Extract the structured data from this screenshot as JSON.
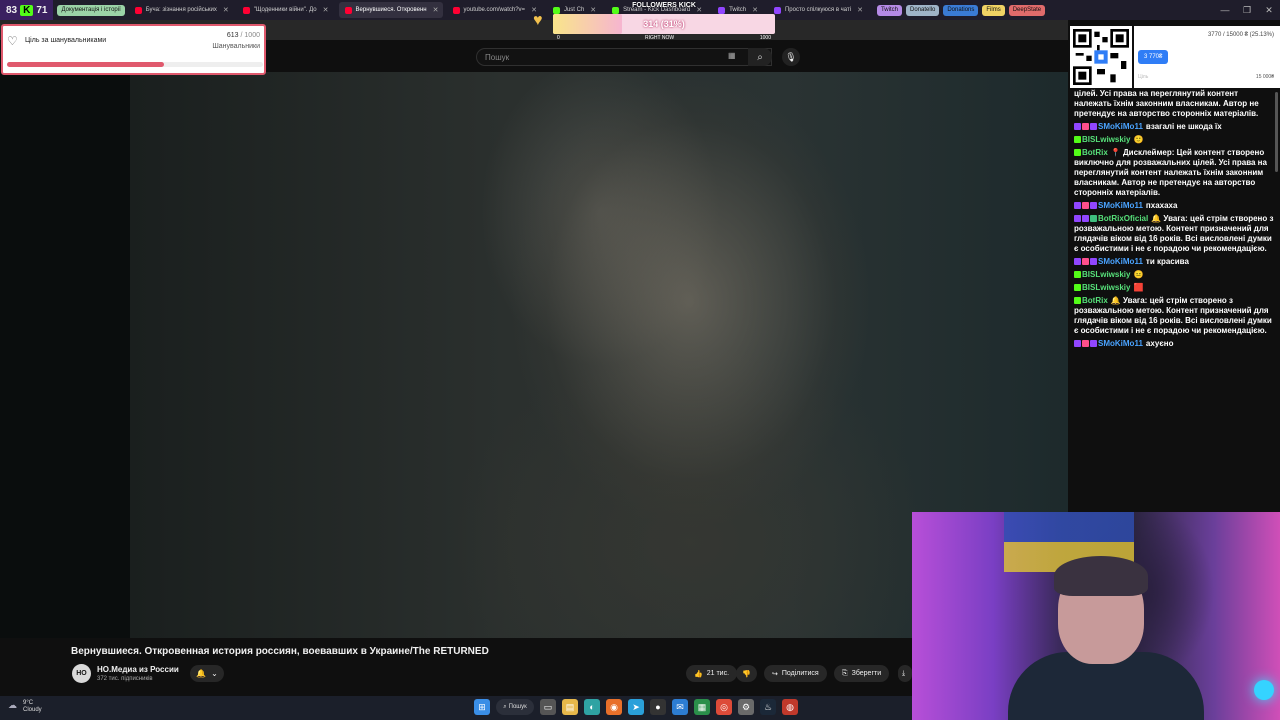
{
  "browser": {
    "stats": {
      "left": "83",
      "right": "71"
    },
    "tabs": [
      {
        "label": "Документація і історії",
        "chip": true,
        "color": "#9bd3a7"
      },
      {
        "label": "Бучa: зізнання російських",
        "color": "#ff0033"
      },
      {
        "label": "\"Щоденники війни\". До",
        "color": "#ff0033"
      },
      {
        "label": "Вернувшиеся. Откровенн",
        "color": "#ff0033",
        "active": true
      },
      {
        "label": "youtube.com/watch?v=",
        "color": "#ff0033"
      },
      {
        "label": "Just Ch",
        "color": "#53fc18"
      },
      {
        "label": "Stream - Kick Dashboard",
        "color": "#53fc18"
      },
      {
        "label": "Twitch",
        "color": "#9146ff"
      },
      {
        "label": "Просто спілкуюся в чаті",
        "color": "#9146ff"
      }
    ],
    "group_chips": [
      {
        "label": "Twitch",
        "color": "#b58ae6"
      },
      {
        "label": "Donatello",
        "color": "#9fb4c8"
      },
      {
        "label": "Donations",
        "color": "#3a7bd5"
      },
      {
        "label": "Films",
        "color": "#f0d264"
      },
      {
        "label": "DeepState",
        "color": "#e06b6b"
      }
    ],
    "window_controls": [
      "—",
      "❐",
      "✕"
    ]
  },
  "youtube": {
    "search_placeholder": "Пошук",
    "video_title": "Вернувшиеся. Откровенная история россиян, воевавших в Украине/The RETURNED",
    "channel": {
      "name": "НО.Медиа из России",
      "subscribers": "372 тис. підписників",
      "avatar": "НО"
    },
    "actions": {
      "likes": "21 тис.",
      "share": "Поділитися",
      "save": "Зберегти"
    }
  },
  "goal_widget": {
    "label": "Ціль за шанувальниками",
    "current": "613",
    "max": " / 1000",
    "sub_label": "Шанувальники",
    "progress": 0.613
  },
  "followers_kick": {
    "title": "FOLLOWERS KICK",
    "value_label": "314 (31%)",
    "progress": 0.31,
    "tick_min": "0",
    "tick_mid": "RIGHT NOW",
    "tick_max": "1000"
  },
  "donation": {
    "top_text": "3770 / 15000 ₴ (25.13%)",
    "current": "3 770₴",
    "label": "Ціль",
    "max": "15 000₴"
  },
  "chat": [
    {
      "user": "",
      "user_color": "#fff",
      "text": "цілей. Усі права на переглянутий контент належать їхнім законним власникам. Автор не претендує на авторство сторонніх матеріалів."
    },
    {
      "user": "SMoKiMo11",
      "user_color": "#4aa3ff",
      "badges": [
        "#9146ff",
        "#ff4f8b",
        "#9146ff"
      ],
      "text": "взагалі не шкода їх"
    },
    {
      "user": "BISLwiwskiy",
      "user_color": "#57e07a",
      "badges": [
        "#53fc18"
      ],
      "text": "🙂"
    },
    {
      "user": "BotRix",
      "user_color": "#57e07a",
      "badges": [
        "#53fc18"
      ],
      "text": "📍 Дисклеймер: Цей контент створено виключно для розважальних цілей. Усі права на переглянутий контент належать їхнім законним власникам. Автор не претендує на авторство сторонніх матеріалів."
    },
    {
      "user": "SMoKiMo11",
      "user_color": "#4aa3ff",
      "badges": [
        "#9146ff",
        "#ff4f8b",
        "#9146ff"
      ],
      "text": "пхахаха"
    },
    {
      "user": "BotRixOficial",
      "user_color": "#57e07a",
      "badges": [
        "#9146ff",
        "#9146ff",
        "#3fbf7f"
      ],
      "text": "🔔 Увага: цей стрім створено з розважальною метою. Контент призначений для глядачів віком від 16 років. Всі висловлені думки є особистими і не є порадою чи рекомендацією."
    },
    {
      "user": "SMoKiMo11",
      "user_color": "#4aa3ff",
      "badges": [
        "#9146ff",
        "#ff4f8b",
        "#9146ff"
      ],
      "text": "ти красива"
    },
    {
      "user": "BISLwiwskiy",
      "user_color": "#57e07a",
      "badges": [
        "#53fc18"
      ],
      "text": "😐"
    },
    {
      "user": "BISLwiwskiy",
      "user_color": "#57e07a",
      "badges": [
        "#53fc18"
      ],
      "text": "🟥"
    },
    {
      "user": "BotRix",
      "user_color": "#57e07a",
      "badges": [
        "#53fc18"
      ],
      "text": "🔔 Увага: цей стрім створено з розважальною метою. Контент призначений для глядачів віком від 16 років. Всі висловлені думки є особистими і не є порадою чи рекомендацією."
    },
    {
      "user": "SMoKiMo11",
      "user_color": "#4aa3ff",
      "badges": [
        "#9146ff",
        "#ff4f8b",
        "#9146ff"
      ],
      "text": "ахуєно"
    }
  ],
  "taskbar": {
    "weather_temp": "9°C",
    "weather_desc": "Cloudy",
    "search_label": "Пошук",
    "apps": [
      {
        "icon": "windows-icon",
        "glyph": "⊞",
        "color": "#3a8ee6"
      },
      {
        "icon": "task-view-icon",
        "glyph": "▭",
        "color": "#555"
      },
      {
        "icon": "file-explorer-icon",
        "glyph": "▤",
        "color": "#e6b84a"
      },
      {
        "icon": "edge-icon",
        "glyph": "◐",
        "color": "#2fa3a3"
      },
      {
        "icon": "firefox-icon",
        "glyph": "◉",
        "color": "#e8702a"
      },
      {
        "icon": "telegram-icon",
        "glyph": "➤",
        "color": "#2aa0da"
      },
      {
        "icon": "obs-icon",
        "glyph": "●",
        "color": "#333"
      },
      {
        "icon": "mail-icon",
        "glyph": "✉",
        "color": "#2d7dd2"
      },
      {
        "icon": "spreadsheet-icon",
        "glyph": "▦",
        "color": "#2a8f4a"
      },
      {
        "icon": "chrome-icon",
        "glyph": "◎",
        "color": "#dd4b39"
      },
      {
        "icon": "settings-icon",
        "glyph": "⚙",
        "color": "#6a6a6a"
      },
      {
        "icon": "steam-icon",
        "glyph": "♨",
        "color": "#1b2838"
      },
      {
        "icon": "record-icon",
        "glyph": "◍",
        "color": "#c0392b"
      }
    ]
  }
}
